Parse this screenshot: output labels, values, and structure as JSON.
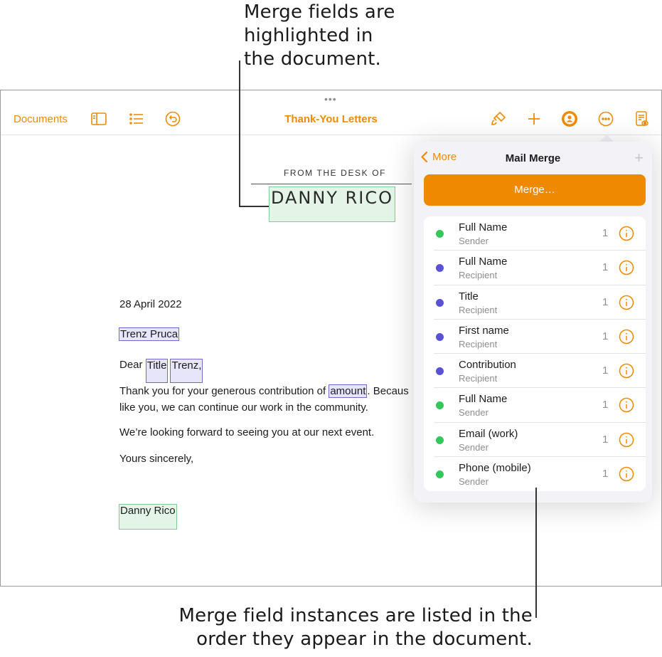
{
  "callouts": {
    "top": [
      "Merge fields are",
      "highlighted in",
      "the document."
    ],
    "bottom": [
      "Merge field instances are listed in the",
      "order they appear in the document."
    ]
  },
  "toolbar": {
    "documents_label": "Documents",
    "title": "Thank-You Letters",
    "icons": [
      "sidebar-icon",
      "list-icon",
      "undo-icon",
      "paintbrush-icon",
      "plus-icon",
      "collaborate-icon",
      "more-icon",
      "reading-view-icon"
    ]
  },
  "document": {
    "letterhead_label": "FROM THE DESK OF",
    "letterhead_name": "DANNY RICO",
    "date": "28 April 2022",
    "recipient_name": "Trenz Pruca",
    "salutation": {
      "prefix": "Dear ",
      "title": "Title",
      "first_name": "Trenz,"
    },
    "body_line1": {
      "before": "Thank you for your generous contribution of ",
      "field": "amount",
      "after": ". Becaus"
    },
    "body_line2": "like you, we can continue our work in the community.",
    "line_event": "We’re looking forward to seeing you at our next event.",
    "closing": "Yours sincerely,",
    "signature": "Danny Rico"
  },
  "mail_merge": {
    "back_label": "More",
    "title": "Mail Merge",
    "add_label": "+",
    "merge_button": "Merge…",
    "colors": {
      "sender": "#34c759",
      "recipient": "#5a52d6",
      "accent": "#f08a00"
    },
    "fields": [
      {
        "name": "Full Name",
        "type": "Sender",
        "count": "1"
      },
      {
        "name": "Full Name",
        "type": "Recipient",
        "count": "1"
      },
      {
        "name": "Title",
        "type": "Recipient",
        "count": "1"
      },
      {
        "name": "First name",
        "type": "Recipient",
        "count": "1"
      },
      {
        "name": "Contribution",
        "type": "Recipient",
        "count": "1"
      },
      {
        "name": "Full Name",
        "type": "Sender",
        "count": "1"
      },
      {
        "name": "Email (work)",
        "type": "Sender",
        "count": "1"
      },
      {
        "name": "Phone (mobile)",
        "type": "Sender",
        "count": "1"
      }
    ]
  }
}
